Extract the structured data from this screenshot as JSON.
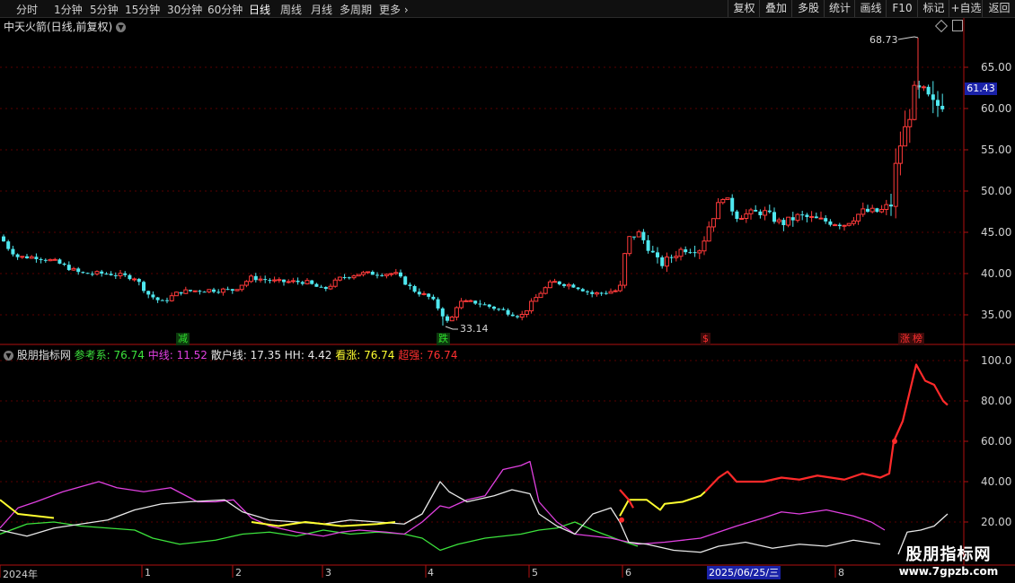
{
  "toolbar": {
    "periods": [
      "分时",
      "1分钟",
      "5分钟",
      "15分钟",
      "30分钟",
      "60分钟",
      "日线",
      "周线",
      "月线",
      "多周期",
      "更多"
    ],
    "active_period": "日线",
    "right_buttons": [
      "复权",
      "叠加",
      "多股",
      "统计",
      "画线",
      "F10",
      "标记",
      "+自选",
      "返回"
    ]
  },
  "main_chart": {
    "title": "中天火箭(日线,前复权)",
    "high_label": "68.73",
    "low_label": "33.14",
    "current_price": "61.43",
    "y_ticks": [
      "65.00",
      "60.00",
      "55.00",
      "50.00",
      "45.00",
      "40.00",
      "35.00"
    ],
    "signals": [
      {
        "text": "减",
        "color": "#2ee02e"
      },
      {
        "text": "跌",
        "color": "#2ee02e"
      },
      {
        "text": "$",
        "color": "#ff3030"
      },
      {
        "text": "涨",
        "color": "#ff3030"
      },
      {
        "text": "榜",
        "color": "#ff3030"
      }
    ]
  },
  "indicator": {
    "name": "股朋指标网",
    "fields": [
      {
        "label": "参考系:",
        "value": "76.74",
        "color": "#3ce23c"
      },
      {
        "label": "中线:",
        "value": "11.52",
        "color": "#e040e0"
      },
      {
        "label": "散户线:",
        "value": "17.35",
        "color": "#e8e8e8"
      },
      {
        "label": "HH:",
        "value": "4.42",
        "color": "#e8e8e8"
      },
      {
        "label": "看涨:",
        "value": "76.74",
        "color": "#ffff30"
      },
      {
        "label": "超强:",
        "value": "76.74",
        "color": "#ff3030"
      }
    ],
    "y_ticks": [
      "100.0",
      "80.00",
      "60.00",
      "40.00",
      "20.00"
    ]
  },
  "x_axis": {
    "labels": [
      "2024年",
      "1",
      "2",
      "3",
      "4",
      "5",
      "6",
      "8"
    ],
    "cursor_date": "2025/06/25/三"
  },
  "watermark": {
    "title": "股朋指标网",
    "url": "www.7gpzb.com"
  }
}
